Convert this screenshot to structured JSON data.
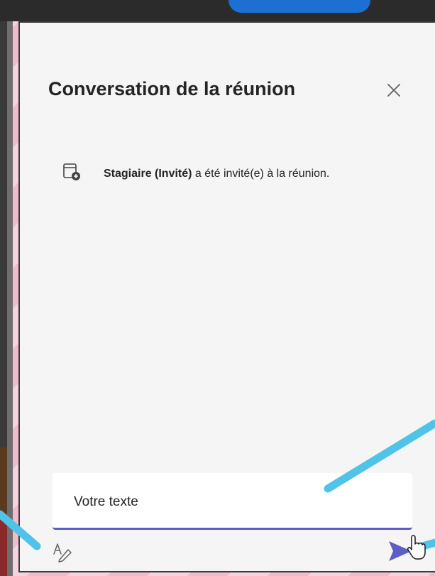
{
  "chat": {
    "title": "Conversation de la réunion",
    "event": {
      "actor": "Stagiaire (Invité)",
      "message": " a été invité(e) à la réunion."
    },
    "compose": {
      "value": "",
      "placeholder": "Votre texte"
    }
  },
  "icons": {
    "close": "close-icon",
    "event": "calendar-add-icon",
    "format": "format-text-icon",
    "send": "send-icon",
    "cursor": "hand-pointer-icon"
  },
  "colors": {
    "accent": "#5b5fc7",
    "annotation_arrow": "#4fc3e8",
    "panel_background": "#f5f5f5"
  }
}
